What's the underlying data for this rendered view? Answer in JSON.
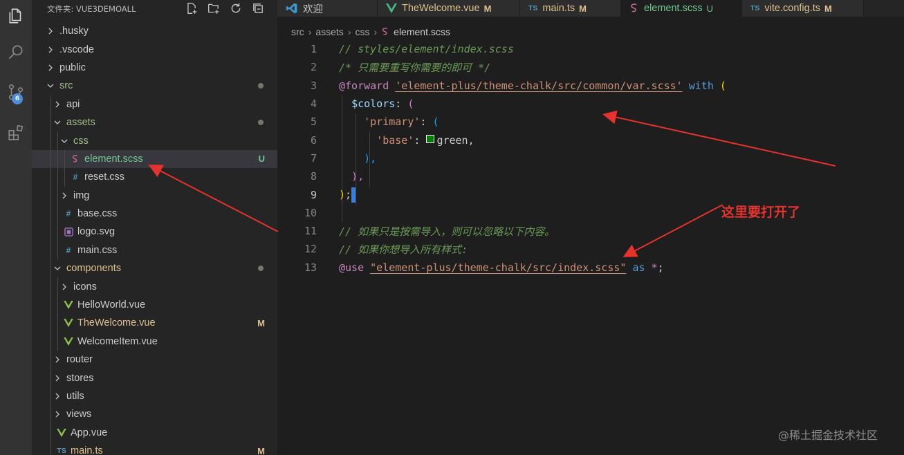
{
  "explorer": {
    "title": "文件夹: VUE3DEMOALL",
    "items": [
      {
        "label": ".husky",
        "type": "folder",
        "expanded": false,
        "depth": 0
      },
      {
        "label": ".vscode",
        "type": "folder",
        "expanded": false,
        "depth": 0
      },
      {
        "label": "public",
        "type": "folder",
        "expanded": false,
        "depth": 0
      },
      {
        "label": "src",
        "type": "folder",
        "expanded": true,
        "depth": 0,
        "dot": true,
        "color": "green"
      },
      {
        "label": "api",
        "type": "folder",
        "expanded": false,
        "depth": 1
      },
      {
        "label": "assets",
        "type": "folder",
        "expanded": true,
        "depth": 1,
        "dot": true,
        "color": "green"
      },
      {
        "label": "css",
        "type": "folder",
        "expanded": true,
        "depth": 2,
        "color": "green"
      },
      {
        "label": "element.scss",
        "type": "scss",
        "depth": 3,
        "status": "U",
        "selected": true,
        "color": "untracked"
      },
      {
        "label": "reset.css",
        "type": "css",
        "depth": 3
      },
      {
        "label": "img",
        "type": "folder",
        "expanded": false,
        "depth": 2
      },
      {
        "label": "base.css",
        "type": "css",
        "depth": 2
      },
      {
        "label": "logo.svg",
        "type": "svg",
        "depth": 2
      },
      {
        "label": "main.css",
        "type": "css",
        "depth": 2
      },
      {
        "label": "components",
        "type": "folder",
        "expanded": true,
        "depth": 1,
        "dot": true,
        "color": "modified"
      },
      {
        "label": "icons",
        "type": "folder",
        "expanded": false,
        "depth": 2
      },
      {
        "label": "HelloWorld.vue",
        "type": "vue",
        "depth": 2
      },
      {
        "label": "TheWelcome.vue",
        "type": "vue",
        "depth": 2,
        "status": "M",
        "color": "modified"
      },
      {
        "label": "WelcomeItem.vue",
        "type": "vue",
        "depth": 2
      },
      {
        "label": "router",
        "type": "folder",
        "expanded": false,
        "depth": 1
      },
      {
        "label": "stores",
        "type": "folder",
        "expanded": false,
        "depth": 1
      },
      {
        "label": "utils",
        "type": "folder",
        "expanded": false,
        "depth": 1
      },
      {
        "label": "views",
        "type": "folder",
        "expanded": false,
        "depth": 1
      },
      {
        "label": "App.vue",
        "type": "vue",
        "depth": 1
      },
      {
        "label": "main.ts",
        "type": "ts",
        "depth": 1,
        "status": "M",
        "color": "modified"
      }
    ]
  },
  "activity": {
    "source_control_badge": "6"
  },
  "tabs": [
    {
      "label": "欢迎",
      "icon": "vscode-logo-icon",
      "status": "",
      "width": 0
    },
    {
      "label": "TheWelcome.vue",
      "icon": "vue-icon",
      "status": "M"
    },
    {
      "label": "main.ts",
      "icon": "ts-icon",
      "status": "M"
    },
    {
      "label": "element.scss",
      "icon": "scss-icon",
      "status": "U",
      "active": true
    },
    {
      "label": "vite.config.ts",
      "icon": "ts-icon",
      "status": "M"
    }
  ],
  "breadcrumb": [
    "src",
    "assets",
    "css",
    "element.scss"
  ],
  "code": {
    "line_numbers": [
      "1",
      "2",
      "3",
      "4",
      "5",
      "6",
      "7",
      "8",
      "9",
      "10",
      "11",
      "12",
      "13"
    ],
    "l1": "// styles/element/index.scss",
    "l2": "/* 只需要重写你需要的即可 */",
    "l3_kw": "@forward",
    "l3_str": "'element-plus/theme-chalk/src/common/var.scss'",
    "l3_with": "with",
    "l3_paren": "(",
    "l4_var": "$colors",
    "l4_colon": ": ",
    "l4_paren": "(",
    "l5_str": "'primary'",
    "l5_colon": ": ",
    "l5_paren": "(",
    "l6_str": "'base'",
    "l6_colon": ": ",
    "l6_val": "green",
    "l6_comma": ",",
    "l7": "),",
    "l8": "),",
    "l9_paren": ")",
    "l9_semi": ";",
    "l11": "// 如果只是按需导入，则可以忽略以下内容。",
    "l12": "// 如果你想导入所有样式:",
    "l13_kw": "@use",
    "l13_str": "\"element-plus/theme-chalk/src/index.scss\"",
    "l13_as": "as",
    "l13_star": "*",
    "l13_semi": ";"
  },
  "annotation": "这里要打开了",
  "watermark": "@稀土掘金技术社区",
  "colors": {
    "accent": "#3b7fd9",
    "modified": "#e2c08d",
    "untracked": "#73c991",
    "annotation": "#e5322d"
  }
}
